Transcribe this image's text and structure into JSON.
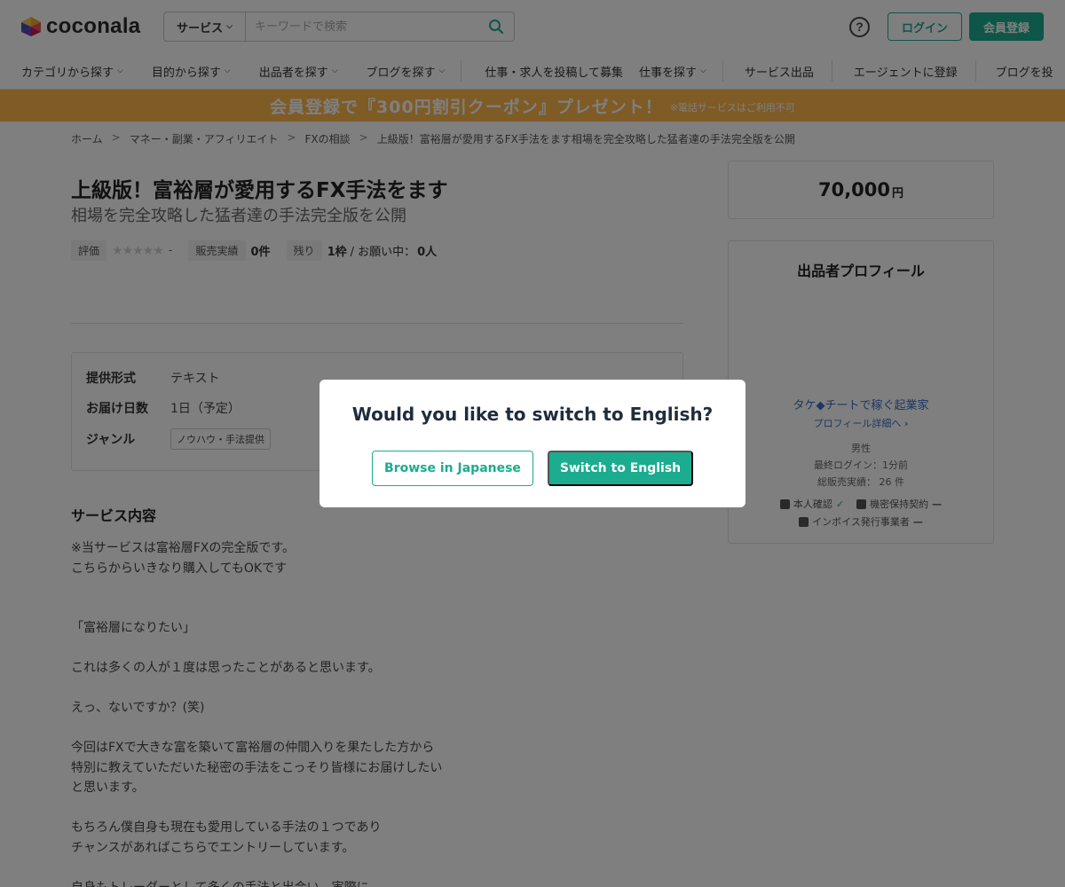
{
  "header": {
    "logo_text": "coconala",
    "search_category": "サービス",
    "search_placeholder": "キーワードで検索",
    "help_label": "?",
    "login_label": "ログイン",
    "register_label": "会員登録"
  },
  "nav": {
    "items": [
      "カテゴリから探す",
      "目的から探す",
      "出品者を探す",
      "ブログを探す",
      "仕事・求人を投稿して募集",
      "仕事を探す",
      "サービス出品",
      "エージェントに登録",
      "ブログを投"
    ]
  },
  "banner": {
    "main": "会員登録で『300円割引クーポン』プレゼント！",
    "note": "※電話サービスはご利用不可"
  },
  "breadcrumb": {
    "items": [
      "ホーム",
      "マネー・副業・アフィリエイト",
      "FXの相談",
      "上級版！富裕層が愛用するFX手法をます相場を完全攻略した猛者達の手法完全版を公開"
    ]
  },
  "service": {
    "title_main": "上級版！富裕層が愛用するFX手法をます",
    "title_sub": "相場を完全攻略した猛者達の手法完全版を公開",
    "rating_label": "評価",
    "rating_stars": 0,
    "rating_value": "-",
    "sales_label": "販売実績",
    "sales_value": "0件",
    "remaining_label": "残り",
    "remaining_value": "1枠",
    "remaining_rest": "/ お願い中：",
    "requests_value": "0人"
  },
  "specs": {
    "format_label": "提供形式",
    "format_value": "テキスト",
    "delivery_label": "お届け日数",
    "delivery_value": "1日（予定）",
    "genre_label": "ジャンル",
    "genre_tag": "ノウハウ・手法提供"
  },
  "description": {
    "section_title": "サービス内容",
    "lines": [
      "※当サービスは富裕層FXの完全版です。",
      "こちらからいきなり購入してもOKです",
      "",
      "",
      "「富裕層になりたい」",
      "",
      "これは多くの人が１度は思ったことがあると思います。",
      "",
      "えっ、ないですか？(笑)",
      "",
      "今回はFXで大きな富を築いて富裕層の仲間入りを果たした方から",
      "特別に教えていただいた秘密の手法をこっそり皆様にお届けしたい",
      "と思います。",
      "",
      "もちろん僕自身も現在も愛用している手法の１つであり",
      "チャンスがあればこちらでエントリーしています。",
      "",
      "自身もトレーダーとして多くの手法と出会い、実際に"
    ]
  },
  "price": {
    "amount": "70,000",
    "unit": "円"
  },
  "profile": {
    "title": "出品者プロフィール",
    "name": "タケ◆チートで稼ぐ起業家",
    "detail_link": "プロフィール詳細へ",
    "gender": "男性",
    "last_login": "最終ログイン：1分前",
    "total_sales": "総販売実績： 26 件",
    "identity_label": "本人確認",
    "identity_mark": "✓",
    "nda_label": "機密保持契約",
    "nda_mark": "—",
    "invoice_label": "インボイス発行事業者",
    "invoice_mark": "—"
  },
  "modal": {
    "question": "Would you like to switch to English?",
    "browse_japanese": "Browse in Japanese",
    "switch_english": "Switch to English"
  },
  "colors": {
    "brand": "#1cac8f",
    "banner": "#ffb74d",
    "link": "#3b6fc4"
  }
}
